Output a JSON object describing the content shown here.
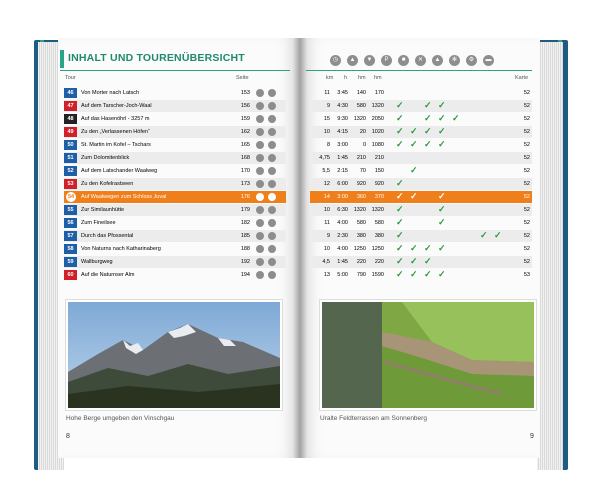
{
  "heading": "INHALT UND TOURENÜBERSICHT",
  "columns": {
    "tour": "Tour",
    "seite": "Seite",
    "km": "km",
    "h": "h",
    "hm1": "hm",
    "hm2": "hm",
    "karte": "Karte"
  },
  "icons": [
    "clock-icon",
    "up-icon",
    "down-icon",
    "parking-icon",
    "bus-icon",
    "food-icon",
    "summit-icon",
    "winter-icon",
    "bike-icon",
    "car-icon"
  ],
  "tours": [
    {
      "no": "46",
      "color": "#1f5fa8",
      "title": "Von Morter nach Latsch",
      "page": "153",
      "km": "11",
      "h": "3:45",
      "up": "140",
      "down": "170",
      "checks": [],
      "karte": "52"
    },
    {
      "no": "47",
      "color": "#d0202a",
      "title": "Auf dem Tarscher-Joch-Waal",
      "page": "156",
      "km": "9",
      "h": "4:30",
      "up": "580",
      "down": "1320",
      "checks": [
        0,
        2,
        3
      ],
      "karte": "52"
    },
    {
      "no": "48",
      "color": "#222222",
      "title": "Auf das Hasenöhrl - 3257 m",
      "page": "159",
      "km": "15",
      "h": "9:30",
      "up": "1320",
      "down": "2050",
      "checks": [
        0,
        2,
        3,
        4
      ],
      "karte": "52"
    },
    {
      "no": "49",
      "color": "#d0202a",
      "title": "Zu den „Verlassenen Höfen“",
      "page": "162",
      "km": "10",
      "h": "4:15",
      "up": "20",
      "down": "1020",
      "checks": [
        0,
        1,
        2,
        3
      ],
      "karte": "52"
    },
    {
      "no": "50",
      "color": "#1f5fa8",
      "title": "St. Martin im Kofel – Tschars",
      "page": "165",
      "km": "8",
      "h": "3:00",
      "up": "0",
      "down": "1080",
      "checks": [
        0,
        1,
        2,
        3
      ],
      "karte": "52"
    },
    {
      "no": "51",
      "color": "#1f5fa8",
      "title": "Zum Dolomitenblick",
      "page": "168",
      "km": "4,75",
      "h": "1:45",
      "up": "210",
      "down": "210",
      "checks": [],
      "karte": "52"
    },
    {
      "no": "52",
      "color": "#1f5fa8",
      "title": "Auf dem Latschander Waalweg",
      "page": "170",
      "km": "5,5",
      "h": "2:15",
      "up": "70",
      "down": "150",
      "checks": [
        1
      ],
      "karte": "52"
    },
    {
      "no": "53",
      "color": "#d0202a",
      "title": "Zu den Kofelrastseen",
      "page": "173",
      "km": "12",
      "h": "6:00",
      "up": "920",
      "down": "920",
      "checks": [
        0
      ],
      "karte": "52"
    },
    {
      "no": "54",
      "color": "#ffffff",
      "title": "Auf Waalwegen zum Schloss Juval",
      "page": "176",
      "km": "14",
      "h": "3:00",
      "up": "360",
      "down": "370",
      "checks": [
        0,
        1,
        3
      ],
      "karte": "52",
      "hl": true
    },
    {
      "no": "55",
      "color": "#1f5fa8",
      "title": "Zur Similaunhütte",
      "page": "179",
      "km": "10",
      "h": "6:30",
      "up": "1320",
      "down": "1320",
      "checks": [
        0,
        3
      ],
      "karte": "52"
    },
    {
      "no": "56",
      "color": "#1f5fa8",
      "title": "Zum Fineilsee",
      "page": "182",
      "km": "11",
      "h": "4:00",
      "up": "580",
      "down": "580",
      "checks": [
        0,
        3
      ],
      "karte": "52"
    },
    {
      "no": "57",
      "color": "#1f5fa8",
      "title": "Durch das Pfossental",
      "page": "185",
      "km": "9",
      "h": "2:30",
      "up": "380",
      "down": "380",
      "checks": [
        0,
        6,
        7
      ],
      "karte": "52"
    },
    {
      "no": "58",
      "color": "#1f5fa8",
      "title": "Von Naturns nach Katharinaberg",
      "page": "188",
      "km": "10",
      "h": "4:00",
      "up": "1250",
      "down": "1250",
      "checks": [
        0,
        1,
        2,
        3
      ],
      "karte": "52"
    },
    {
      "no": "59",
      "color": "#1f5fa8",
      "title": "Wallburgweg",
      "page": "192",
      "km": "4,5",
      "h": "1:45",
      "up": "220",
      "down": "220",
      "checks": [
        0,
        1,
        2
      ],
      "karte": "52"
    },
    {
      "no": "60",
      "color": "#d0202a",
      "title": "Auf die Naturnser Alm",
      "page": "194",
      "km": "13",
      "h": "5:00",
      "up": "790",
      "down": "1590",
      "checks": [
        0,
        1,
        2,
        3
      ],
      "karte": "53"
    }
  ],
  "captions": {
    "left": "Hohe Berge umgeben den Vinschgau",
    "right": "Uralte Feldterrassen am Sonnenberg"
  },
  "page_numbers": {
    "left": "8",
    "right": "9"
  }
}
